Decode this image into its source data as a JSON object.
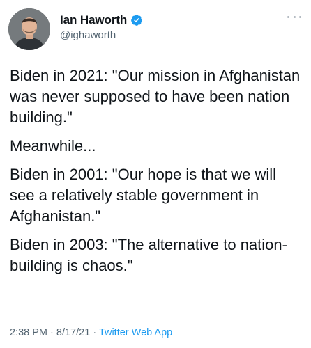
{
  "author": {
    "display_name": "Ian Haworth",
    "handle": "@ighaworth",
    "verified": true
  },
  "tweet": {
    "paragraphs": [
      "Biden in 2021: \"Our mission in Afghanistan was never supposed to have been nation building.\"",
      "Meanwhile...",
      "Biden in 2001: \"Our hope is that we will see a relatively stable government in Afghanistan.\"",
      "Biden in 2003: \"The alternative to nation-building is chaos.\""
    ],
    "time": "2:38 PM",
    "date": "8/17/21",
    "separator": "·",
    "source": "Twitter Web App"
  },
  "icons": {
    "verified": "verified-badge-icon",
    "more": "more-options-icon"
  },
  "colors": {
    "text": "#0f1419",
    "secondary": "#536471",
    "accent": "#1d9bf0"
  }
}
